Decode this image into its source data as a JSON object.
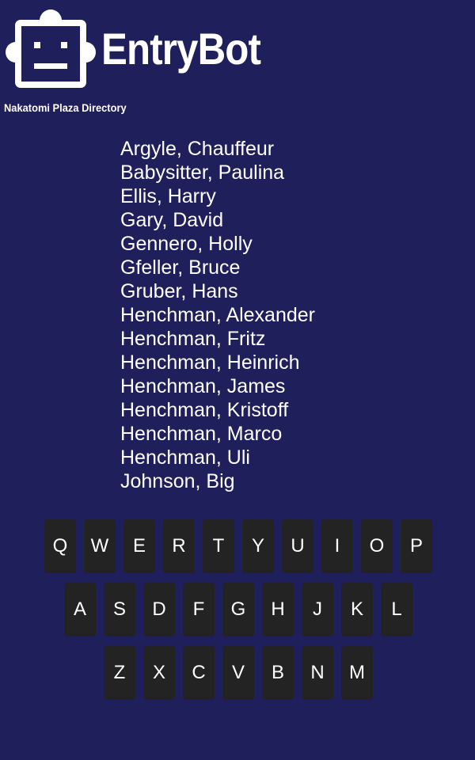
{
  "header": {
    "app_name": "EntryBot",
    "subtitle": "Nakatomi Plaza Directory",
    "logo_icon": "robot-face-icon"
  },
  "directory": {
    "entries": [
      "Argyle, Chauffeur",
      "Babysitter, Paulina",
      "Ellis, Harry",
      "Gary, David",
      "Gennero, Holly",
      "Gfeller, Bruce",
      "Gruber, Hans",
      "Henchman, Alexander",
      "Henchman, Fritz",
      "Henchman, Heinrich",
      "Henchman, James",
      "Henchman, Kristoff",
      "Henchman, Marco",
      "Henchman, Uli",
      "Johnson, Big"
    ]
  },
  "keyboard": {
    "row1": [
      "Q",
      "W",
      "E",
      "R",
      "T",
      "Y",
      "U",
      "I",
      "O",
      "P"
    ],
    "row2": [
      "A",
      "S",
      "D",
      "F",
      "G",
      "H",
      "J",
      "K",
      "L"
    ],
    "row3": [
      "Z",
      "X",
      "C",
      "V",
      "B",
      "N",
      "M"
    ]
  },
  "colors": {
    "background": "#1f1f5c",
    "key_background": "#232323",
    "text": "#ffffff"
  }
}
